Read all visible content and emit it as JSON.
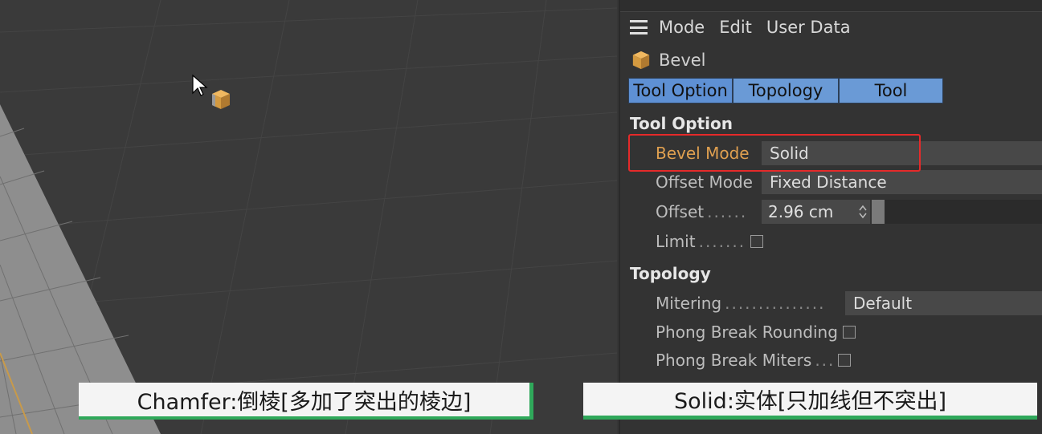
{
  "menu": {
    "items": [
      "Mode",
      "Edit",
      "User Data"
    ]
  },
  "object": {
    "name": "Bevel",
    "icon": "bevel-cube-icon"
  },
  "tabs": [
    "Tool Option",
    "Topology",
    "Tool"
  ],
  "tool_option": {
    "title": "Tool Option",
    "bevel_mode": {
      "label": "Bevel Mode",
      "value": "Solid"
    },
    "offset_mode": {
      "label": "Offset Mode",
      "value": "Fixed Distance"
    },
    "offset": {
      "label": "Offset",
      "dots": "......",
      "value": "2.96 cm"
    },
    "limit": {
      "label": "Limit",
      "dots": ".......",
      "checked": false
    }
  },
  "topology": {
    "title": "Topology",
    "mitering": {
      "label": "Mitering",
      "dots": "...............",
      "value": "Default"
    },
    "phong_rounding": {
      "label": "Phong Break Rounding",
      "checked": false
    },
    "phong_miters": {
      "label": "Phong Break Miters",
      "dots": "...",
      "checked": false
    }
  },
  "subtitles": {
    "left": "Chamfer:倒棱[多加了突出的棱边]",
    "right": "Solid:实体[只加线但不突出]"
  },
  "colors": {
    "tab_active": "#5e90d4",
    "highlight_label": "#e0a050",
    "annotation_box": "#e52a2a",
    "subtitle_accent": "#2fa85a"
  }
}
